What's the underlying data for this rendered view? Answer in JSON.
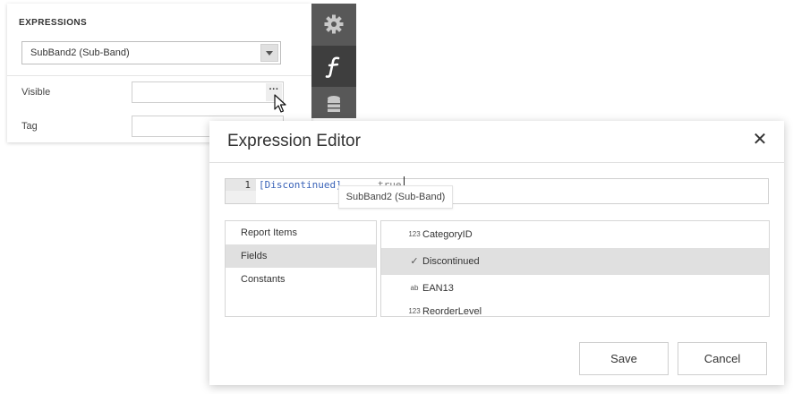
{
  "properties": {
    "section_title": "EXPRESSIONS",
    "band_select_value": "SubBand2 (Sub-Band)",
    "visible_label": "Visible",
    "visible_button": "···",
    "tag_label": "Tag"
  },
  "side_tabs": [
    {
      "icon": "gear-icon"
    },
    {
      "icon": "function-icon",
      "active": true
    },
    {
      "icon": "database-icon"
    }
  ],
  "dialog": {
    "title": "Expression Editor",
    "close": "✕",
    "code": {
      "line_number": "1",
      "expression": "[Discontinued]",
      "trailing": "true"
    },
    "tooltip": "SubBand2 (Sub-Band)",
    "categories": [
      {
        "label": "Report Items"
      },
      {
        "label": "Fields",
        "selected": true
      },
      {
        "label": "Constants"
      }
    ],
    "fields": [
      {
        "icon": "123",
        "label": "CategoryID"
      },
      {
        "icon": "✓",
        "label": "Discontinued",
        "selected": true
      },
      {
        "icon": "ab",
        "label": "EAN13"
      },
      {
        "icon": "123",
        "label": "ReorderLevel"
      }
    ],
    "save_label": "Save",
    "cancel_label": "Cancel"
  },
  "colors": {
    "tab_strip": "#585858",
    "tab_active": "#3e3e3e",
    "selection": "#e0e0e0",
    "code_blue": "#3a63b8"
  }
}
